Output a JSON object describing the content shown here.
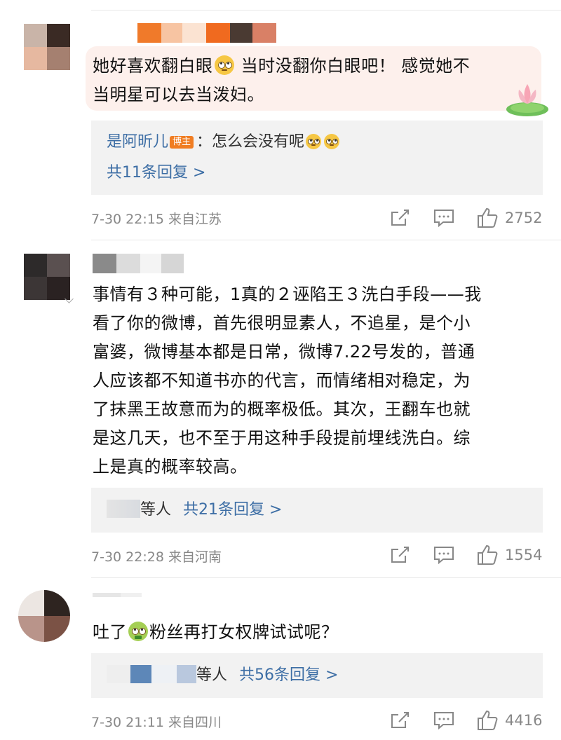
{
  "comments": [
    {
      "text_lines": [
        "她好喜欢翻白眼",
        " 当时没翻你白眼吧！ 感觉她不",
        "当明星可以去当泼妇。"
      ],
      "emoji": "eye-roll-emoji",
      "reply": {
        "author": "是阿昕儿",
        "badge": "博主",
        "text": "：怎么会没有呢",
        "total": "共11条回复 >"
      },
      "meta": "7-30 22:15 来自江苏",
      "likes": "2752"
    },
    {
      "text_lines": [
        "事情有３种可能，1真的２诬陷王３洗白手段——我",
        "看了你的微博，首先很明显素人，不追星，是个小",
        "富婆，微博基本都是日常，微博7.22号发的，普通",
        "人应该都不知道书亦的代言，而情绪相对稳定，为",
        "了抹黑王故意而为的概率极低。其次，王翻车也就",
        "是这几天，也不至于用这种手段提前埋线洗白。综",
        "上是真的概率较高。"
      ],
      "reply": {
        "others": "等人",
        "total": "共21条回复 >"
      },
      "meta": "7-30 22:28 来自河南",
      "likes": "1554"
    },
    {
      "text_before": "吐了",
      "text_after": "粉丝再打女权牌试试呢？",
      "emoji": "vomit-emoji",
      "reply": {
        "others": "等人",
        "total": "共56条回复 >"
      },
      "meta": "7-30 21:11 来自四川",
      "likes": "4416"
    }
  ],
  "colors": {
    "link_blue": "#3d6ea5",
    "meta_grey": "#888888",
    "reply_bg": "#f2f2f2",
    "badge_orange": "#f07d22",
    "highlight_pink": "#fdf0ec"
  }
}
